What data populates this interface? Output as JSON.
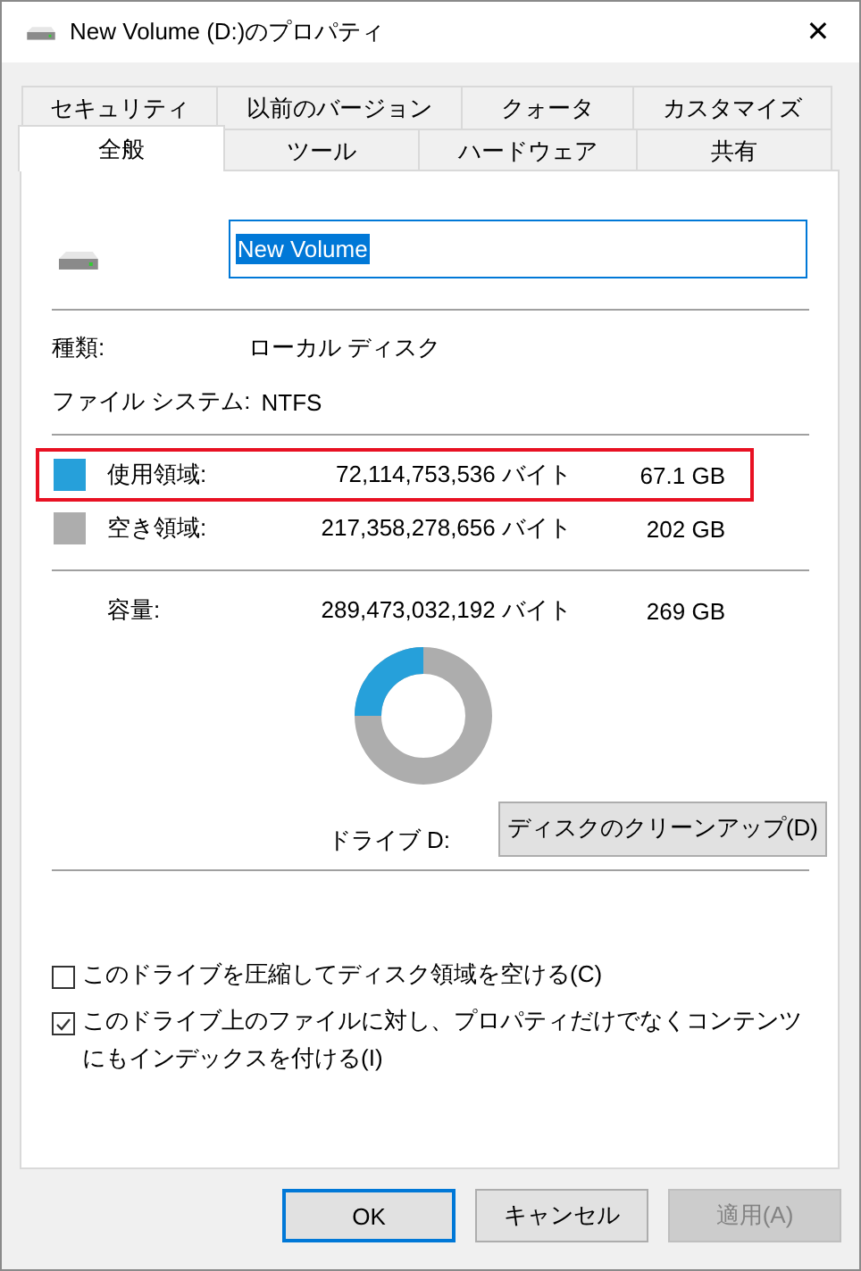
{
  "window": {
    "title": "New Volume (D:)のプロパティ",
    "close": "✕"
  },
  "tab_rows": [
    [
      {
        "label": "セキュリティ",
        "selected": false
      },
      {
        "label": "以前のバージョン",
        "selected": false
      },
      {
        "label": "クォータ",
        "selected": false
      },
      {
        "label": "カスタマイズ",
        "selected": false
      }
    ],
    [
      {
        "label": "全般",
        "selected": true
      },
      {
        "label": "ツール",
        "selected": false
      },
      {
        "label": "ハードウェア",
        "selected": false
      },
      {
        "label": "共有",
        "selected": false
      }
    ]
  ],
  "volume_name": {
    "value": "New Volume",
    "selected": true
  },
  "info": [
    {
      "label": "種類:",
      "value": "ローカル ディスク"
    },
    {
      "label": "ファイル システム:",
      "value": "NTFS"
    }
  ],
  "space": [
    {
      "label": "使用領域:",
      "bytes": "72,114,753,536 バイト",
      "size": "67.1 GB",
      "color": "#26a0da",
      "highlighted": true
    },
    {
      "label": "空き領域:",
      "bytes": "217,358,278,656 バイト",
      "size": "202 GB",
      "color": "#adadad",
      "highlighted": false
    }
  ],
  "capacity": {
    "label": "容量:",
    "bytes": "289,473,032,192 バイト",
    "size": "269 GB"
  },
  "drive_label": "ドライブ D:",
  "cleanup_button": "ディスクのクリーンアップ(D)",
  "options": [
    {
      "label": "このドライブを圧縮してディスク領域を空ける(C)",
      "checked": false
    },
    {
      "label": "このドライブ上のファイルに対し、プロパティだけでなくコンテンツにもインデックスを付ける(I)",
      "checked": true
    }
  ],
  "buttons": [
    {
      "label": "OK",
      "kind": "default",
      "disabled": false
    },
    {
      "label": "キャンセル",
      "kind": "normal",
      "disabled": false
    },
    {
      "label": "適用(A)",
      "kind": "normal",
      "disabled": true
    }
  ]
}
